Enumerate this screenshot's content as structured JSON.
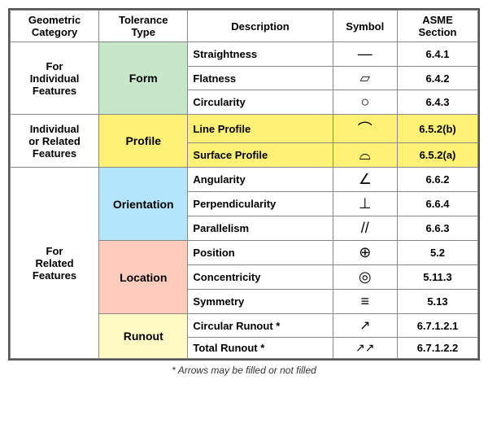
{
  "headers": {
    "col1": "Geometric\nCategory",
    "col2": "Tolerance\nType",
    "col3": "Description",
    "col4": "Symbol",
    "col5": "ASME\nSection"
  },
  "rows": [
    {
      "category": "For\nIndividual\nFeatures",
      "category_rowspan": 3,
      "tolerance": "Form",
      "tolerance_rowspan": 3,
      "tolerance_bg": "bg-green",
      "items": [
        {
          "description": "Straightness",
          "symbol": "—",
          "asme": "6.4.1",
          "row_bg": "bg-white",
          "asme_bg": "bg-white"
        },
        {
          "description": "Flatness",
          "symbol": "▱",
          "asme": "6.4.2",
          "row_bg": "bg-white",
          "asme_bg": "bg-white"
        },
        {
          "description": "Circularity",
          "symbol": "○",
          "asme": "6.4.3",
          "row_bg": "bg-white",
          "asme_bg": "bg-white"
        }
      ]
    },
    {
      "category": "Individual\nor Related\nFeatures",
      "category_rowspan": 2,
      "tolerance": "Profile",
      "tolerance_rowspan": 2,
      "tolerance_bg": "bg-yellow",
      "items": [
        {
          "description": "Line Profile",
          "symbol": "⌒",
          "asme": "6.5.2(b)",
          "row_bg": "bg-yellow",
          "asme_bg": "bg-yellow"
        },
        {
          "description": "Surface Profile",
          "symbol": "⌓",
          "asme": "6.5.2(a)",
          "row_bg": "bg-yellow",
          "asme_bg": "bg-yellow"
        }
      ]
    },
    {
      "category": "For\nRelated\nFeatures",
      "category_rowspan": 8,
      "groups": [
        {
          "tolerance": "Orientation",
          "tolerance_rowspan": 3,
          "tolerance_bg": "bg-light-blue",
          "items": [
            {
              "description": "Angularity",
              "symbol": "∠",
              "asme": "6.6.2",
              "row_bg": "bg-white",
              "asme_bg": "bg-white"
            },
            {
              "description": "Perpendicularity",
              "symbol": "⊥",
              "asme": "6.6.4",
              "row_bg": "bg-white",
              "asme_bg": "bg-white"
            },
            {
              "description": "Parallelism",
              "symbol": "//",
              "asme": "6.6.3",
              "row_bg": "bg-white",
              "asme_bg": "bg-white"
            }
          ]
        },
        {
          "tolerance": "Location",
          "tolerance_rowspan": 3,
          "tolerance_bg": "bg-peach",
          "items": [
            {
              "description": "Position",
              "symbol": "⊕",
              "asme": "5.2",
              "row_bg": "bg-white",
              "asme_bg": "bg-white"
            },
            {
              "description": "Concentricity",
              "symbol": "◎",
              "asme": "5.11.3",
              "row_bg": "bg-white",
              "asme_bg": "bg-white"
            },
            {
              "description": "Symmetry",
              "symbol": "≡",
              "asme": "5.13",
              "row_bg": "bg-white",
              "asme_bg": "bg-white"
            }
          ]
        },
        {
          "tolerance": "Runout",
          "tolerance_rowspan": 2,
          "tolerance_bg": "bg-light-yellow",
          "items": [
            {
              "description": "Circular Runout *",
              "symbol": "↗",
              "asme": "6.7.1.2.1",
              "row_bg": "bg-white",
              "asme_bg": "bg-white"
            },
            {
              "description": "Total Runout *",
              "symbol": "↗↗",
              "asme": "6.7.1.2.2",
              "row_bg": "bg-white",
              "asme_bg": "bg-white"
            }
          ]
        }
      ]
    }
  ],
  "footnote": "* Arrows may be filled or not filled"
}
